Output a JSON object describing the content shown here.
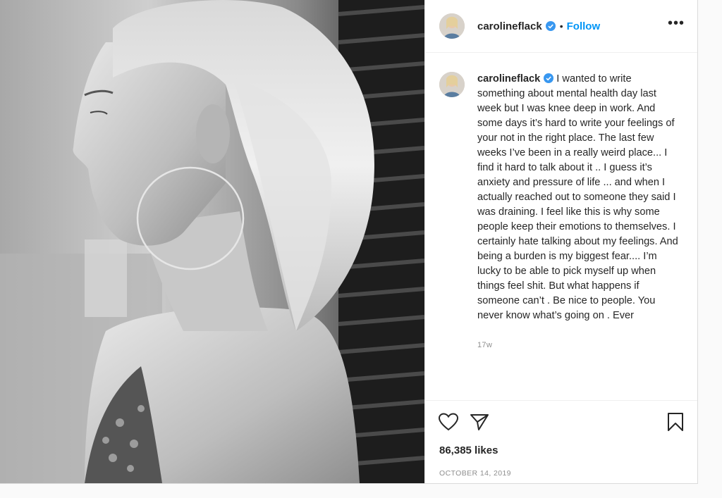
{
  "post": {
    "username": "carolineflack",
    "follow_label": "Follow",
    "dot": "•",
    "more_label": "•••",
    "caption": "I wanted to write something about mental health day last week but I was knee deep in work. And some days it’s hard to write your feelings of your not in the right place. The last few weeks I’ve been in a really weird place... I find it hard to talk about it .. I guess it’s anxiety and pressure of life ... and when I actually reached out to someone they said I was draining. I feel like this is why some people keep their emotions to themselves. I certainly hate talking about my feelings. And being a burden is my biggest fear.... I’m lucky to be able to pick myself up when things feel shit. But what happens if someone can’t . Be nice to people. You never know what’s going on . Ever",
    "time_ago": "17w",
    "likes": "86,385 likes",
    "date": "OCTOBER 14, 2019"
  },
  "icons": {
    "verified": "verified-badge-icon",
    "like": "heart-icon",
    "share": "paper-plane-icon",
    "save": "bookmark-icon"
  },
  "colors": {
    "accent": "#0095f6",
    "verified": "#3897f0",
    "text": "#262626",
    "muted": "#8e8e8e"
  }
}
